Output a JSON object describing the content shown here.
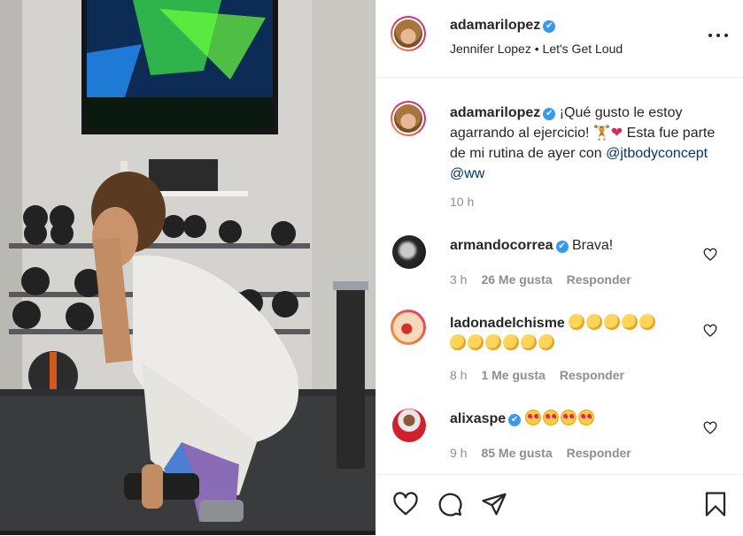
{
  "post": {
    "author": {
      "username": "adamarilopez",
      "verified_badge": "✔",
      "song_artist": "Jennifer Lopez",
      "song_separator": "•",
      "song_title": "Let's Get Loud"
    },
    "caption": {
      "username": "adamarilopez",
      "text_part1": "¡Qué gusto le estoy agarrando al ejercicio! ",
      "emoji_1": "🏋",
      "emoji_2": "❤",
      "text_part2": " Esta fue parte de mi rutina de ayer con ",
      "mention_1": "@jtbodyconcept",
      "mention_2": "@ww",
      "time": "10 h"
    },
    "comments": [
      {
        "username": "armandocorrea",
        "verified": true,
        "text": "Brava!",
        "time": "3 h",
        "likes": "26 Me gusta",
        "reply": "Responder"
      },
      {
        "username": "ladonadelchisme",
        "verified": false,
        "text_line1_emojis": 5,
        "text_line2_emojis": 6,
        "time": "8 h",
        "likes": "1 Me gusta",
        "reply": "Responder"
      },
      {
        "username": "alixaspe",
        "verified": true,
        "text_emojis": 4,
        "time": "9 h",
        "likes": "85 Me gusta",
        "reply": "Responder"
      }
    ],
    "actions": {
      "like_icon": "heart-icon",
      "comment_icon": "comment-icon",
      "share_icon": "paper-plane-icon",
      "save_icon": "bookmark-icon"
    }
  },
  "colors": {
    "verified": "#3897f0",
    "mention": "#00376b",
    "muted": "#8e8e8e",
    "text": "#262626",
    "avatar_ring": "#e1306c"
  }
}
